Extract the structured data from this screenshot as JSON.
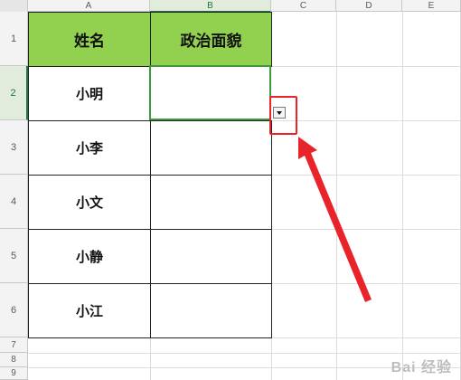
{
  "columns": [
    "A",
    "B",
    "C",
    "D",
    "E"
  ],
  "rows": [
    "1",
    "2",
    "3",
    "4",
    "5",
    "6",
    "7",
    "8",
    "9"
  ],
  "table": {
    "header_a": "姓名",
    "header_b": "政治面貌",
    "names": [
      "小明",
      "小李",
      "小文",
      "小静",
      "小江"
    ]
  },
  "colors": {
    "header_fill": "#92d050",
    "selection": "#3f9a3f",
    "annotation": "#e8232a"
  },
  "watermark": "Bai 经验"
}
